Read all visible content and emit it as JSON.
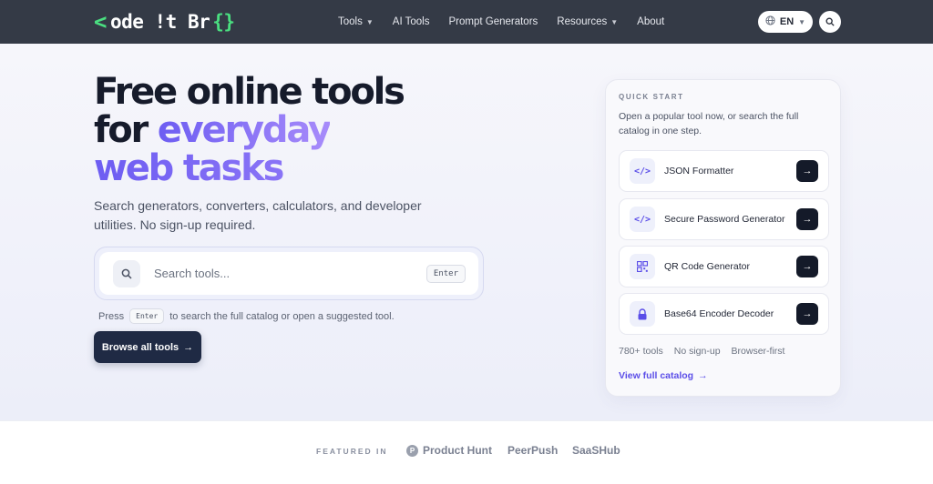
{
  "header": {
    "logo": {
      "chevron": "<",
      "text": "ode !t Br",
      "brace": "{}"
    },
    "nav": [
      {
        "label": "Tools",
        "has_caret": true
      },
      {
        "label": "AI Tools",
        "has_caret": false
      },
      {
        "label": "Prompt Generators",
        "has_caret": false
      },
      {
        "label": "Resources",
        "has_caret": true
      },
      {
        "label": "About",
        "has_caret": false
      }
    ],
    "language": "EN"
  },
  "hero": {
    "title_line1": "Free online tools",
    "title_line2_prefix": "for ",
    "title_line2_accent": "everyday",
    "title_line3_accent": "web tasks",
    "subtitle": "Search generators, converters, calculators, and developer utilities. No sign-up required.",
    "search": {
      "placeholder": "Search tools...",
      "key_hint": "Enter"
    },
    "hint": {
      "prefix": "Press",
      "key": "Enter",
      "suffix": "to search the full catalog or open a suggested tool."
    },
    "browse_button": "Browse all tools"
  },
  "quick_start": {
    "label": "QUICK START",
    "description": "Open a popular tool now, or search the full catalog in one step.",
    "items": [
      {
        "name": "JSON Formatter",
        "icon": "code-icon"
      },
      {
        "name": "Secure Password Generator",
        "icon": "code-icon"
      },
      {
        "name": "QR Code Generator",
        "icon": "qr-code-icon"
      },
      {
        "name": "Base64 Encoder Decoder",
        "icon": "lock-icon"
      }
    ],
    "meta": [
      "780+ tools",
      "No sign-up",
      "Browser-first"
    ],
    "link": "View full catalog"
  },
  "featured": {
    "label": "FEATURED IN",
    "items": [
      "Product Hunt",
      "PeerPush",
      "SaaSHub"
    ]
  },
  "colors": {
    "header_bg": "#343a46",
    "accent": "#5b4ee8",
    "logo_green": "#4ade80",
    "primary_button": "#1f2a44"
  }
}
